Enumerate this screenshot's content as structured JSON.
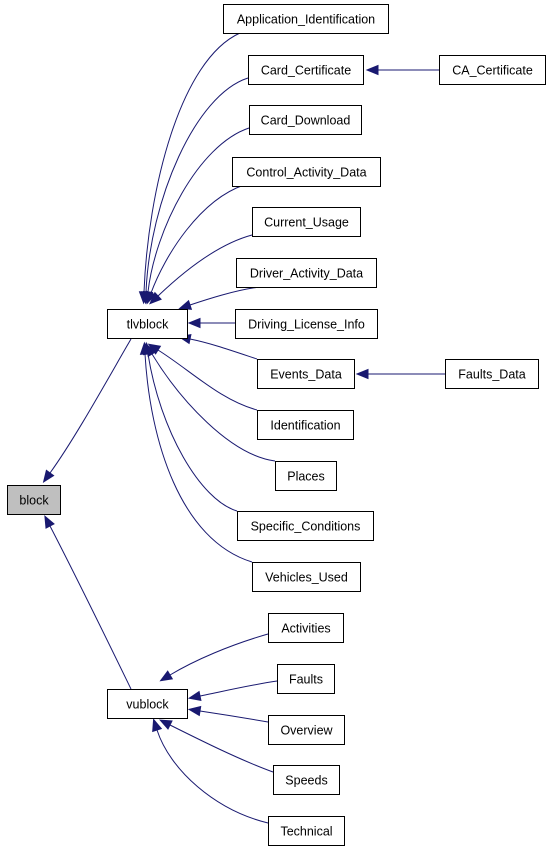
{
  "diagram": {
    "type": "class-inheritance-graph",
    "direction": "right-to-left",
    "colors": {
      "edge": "#191970",
      "node_border": "#000000",
      "node_fill": "#ffffff",
      "root_fill": "#bfbfbf",
      "text": "#000000"
    },
    "root": "block",
    "nodes": [
      {
        "id": "block",
        "label": "block",
        "highlighted": true
      },
      {
        "id": "tlvblock",
        "label": "tlvblock"
      },
      {
        "id": "vublock",
        "label": "vublock"
      },
      {
        "id": "Application_Identification",
        "label": "Application_Identification"
      },
      {
        "id": "Card_Certificate",
        "label": "Card_Certificate"
      },
      {
        "id": "CA_Certificate",
        "label": "CA_Certificate"
      },
      {
        "id": "Card_Download",
        "label": "Card_Download"
      },
      {
        "id": "Control_Activity_Data",
        "label": "Control_Activity_Data"
      },
      {
        "id": "Current_Usage",
        "label": "Current_Usage"
      },
      {
        "id": "Driver_Activity_Data",
        "label": "Driver_Activity_Data"
      },
      {
        "id": "Driving_License_Info",
        "label": "Driving_License_Info"
      },
      {
        "id": "Events_Data",
        "label": "Events_Data"
      },
      {
        "id": "Faults_Data",
        "label": "Faults_Data"
      },
      {
        "id": "Identification",
        "label": "Identification"
      },
      {
        "id": "Places",
        "label": "Places"
      },
      {
        "id": "Specific_Conditions",
        "label": "Specific_Conditions"
      },
      {
        "id": "Vehicles_Used",
        "label": "Vehicles_Used"
      },
      {
        "id": "Activities",
        "label": "Activities"
      },
      {
        "id": "Faults",
        "label": "Faults"
      },
      {
        "id": "Overview",
        "label": "Overview"
      },
      {
        "id": "Speeds",
        "label": "Speeds"
      },
      {
        "id": "Technical",
        "label": "Technical"
      }
    ],
    "edges": [
      {
        "from": "tlvblock",
        "to": "block"
      },
      {
        "from": "vublock",
        "to": "block"
      },
      {
        "from": "Application_Identification",
        "to": "tlvblock"
      },
      {
        "from": "Card_Certificate",
        "to": "tlvblock"
      },
      {
        "from": "CA_Certificate",
        "to": "Card_Certificate"
      },
      {
        "from": "Card_Download",
        "to": "tlvblock"
      },
      {
        "from": "Control_Activity_Data",
        "to": "tlvblock"
      },
      {
        "from": "Current_Usage",
        "to": "tlvblock"
      },
      {
        "from": "Driver_Activity_Data",
        "to": "tlvblock"
      },
      {
        "from": "Driving_License_Info",
        "to": "tlvblock"
      },
      {
        "from": "Events_Data",
        "to": "tlvblock"
      },
      {
        "from": "Faults_Data",
        "to": "Events_Data"
      },
      {
        "from": "Identification",
        "to": "tlvblock"
      },
      {
        "from": "Places",
        "to": "tlvblock"
      },
      {
        "from": "Specific_Conditions",
        "to": "tlvblock"
      },
      {
        "from": "Vehicles_Used",
        "to": "tlvblock"
      },
      {
        "from": "Activities",
        "to": "vublock"
      },
      {
        "from": "Faults",
        "to": "vublock"
      },
      {
        "from": "Overview",
        "to": "vublock"
      },
      {
        "from": "Speeds",
        "to": "vublock"
      },
      {
        "from": "Technical",
        "to": "vublock"
      }
    ]
  }
}
